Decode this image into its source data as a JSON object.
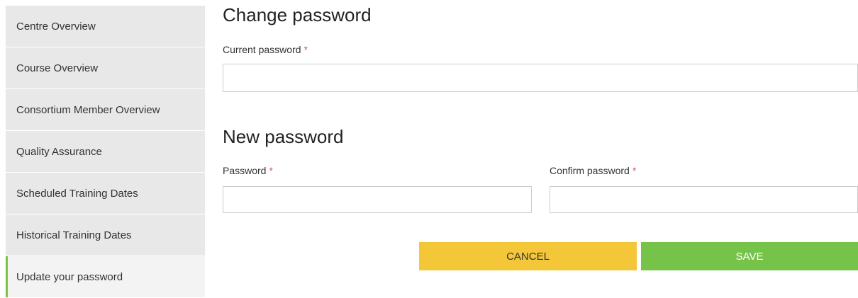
{
  "sidebar": {
    "items": [
      {
        "label": "Centre Overview"
      },
      {
        "label": "Course Overview"
      },
      {
        "label": "Consortium Member Overview"
      },
      {
        "label": "Quality Assurance"
      },
      {
        "label": "Scheduled Training Dates"
      },
      {
        "label": "Historical Training Dates"
      },
      {
        "label": "Update your password",
        "active": true
      }
    ]
  },
  "change_password": {
    "title": "Change password",
    "current_label": "Current password",
    "required_marker": "*",
    "current_value": ""
  },
  "new_password": {
    "title": "New password",
    "password_label": "Password",
    "confirm_label": "Confirm password",
    "password_value": "",
    "confirm_value": ""
  },
  "actions": {
    "cancel_label": "CANCEL",
    "save_label": "SAVE"
  },
  "colors": {
    "accent_green": "#76c34a",
    "accent_yellow": "#f3c737",
    "required_red": "#d9534f",
    "sidebar_bg": "#e8e8e8"
  }
}
